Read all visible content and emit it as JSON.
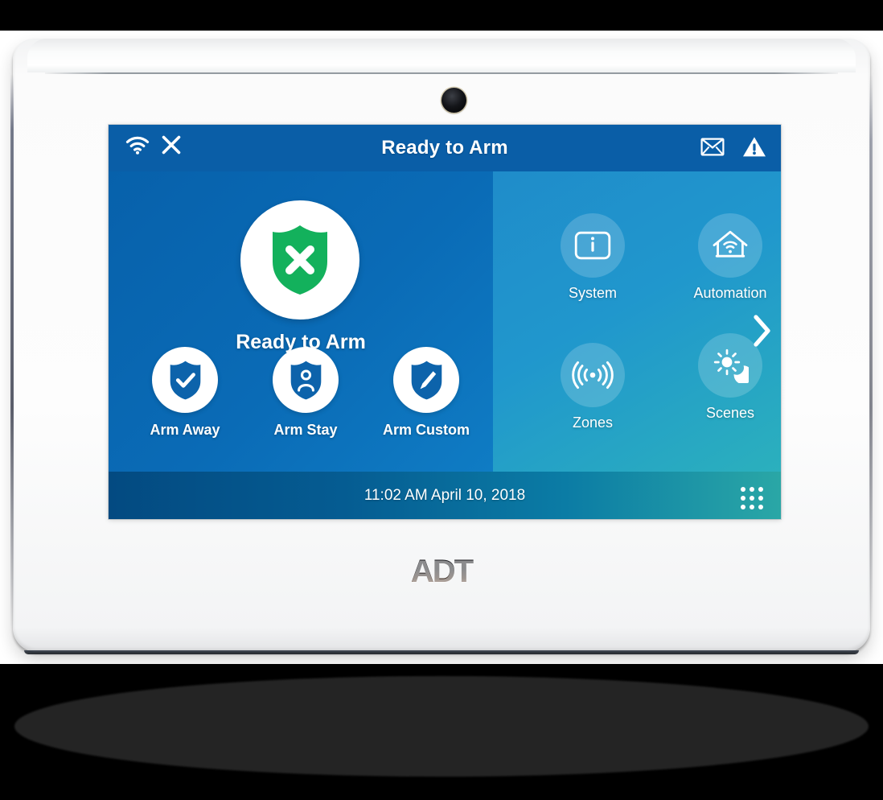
{
  "device": {
    "brand": "ADT",
    "camera": "camera-lens"
  },
  "screen": {
    "title": "Ready to Arm",
    "status_icons_left": [
      {
        "name": "wifi-icon",
        "label": "Wi-Fi"
      },
      {
        "name": "cellular-disconnected-icon",
        "label": "X"
      }
    ],
    "status_icons_right": [
      {
        "name": "mail-icon",
        "label": "Messages"
      },
      {
        "name": "alert-triangle-icon",
        "label": "Alerts"
      }
    ],
    "security": {
      "state_icon": "shield-x-icon",
      "state_label": "Ready to Arm",
      "shield_color": "#13b15c"
    },
    "arm_buttons": [
      {
        "id": "arm-away",
        "label": "Arm Away",
        "icon": "shield-check-icon"
      },
      {
        "id": "arm-stay",
        "label": "Arm Stay",
        "icon": "shield-person-icon"
      },
      {
        "id": "arm-custom",
        "label": "Arm Custom",
        "icon": "shield-pencil-icon"
      }
    ],
    "tiles": [
      {
        "id": "system",
        "label": "System",
        "icon": "info-box-icon"
      },
      {
        "id": "automation",
        "label": "Automation",
        "icon": "home-wifi-icon"
      },
      {
        "id": "zones",
        "label": "Zones",
        "icon": "motion-sensor-icon"
      },
      {
        "id": "scenes",
        "label": "Scenes",
        "icon": "sun-moon-icon"
      }
    ],
    "pagination": {
      "next_icon": "chevron-right-icon"
    },
    "status_bar": {
      "clock": "11:02 AM April 10, 2018",
      "keypad_icon": "keypad-grid-icon"
    },
    "colors": {
      "title_bar": "#0a5ea7",
      "panel_left": "#0a6bb6",
      "panel_right": "#2097cd",
      "status_bar_start": "#034a81",
      "status_bar_end": "#2aa7a6",
      "ready_green": "#13b15c"
    }
  }
}
